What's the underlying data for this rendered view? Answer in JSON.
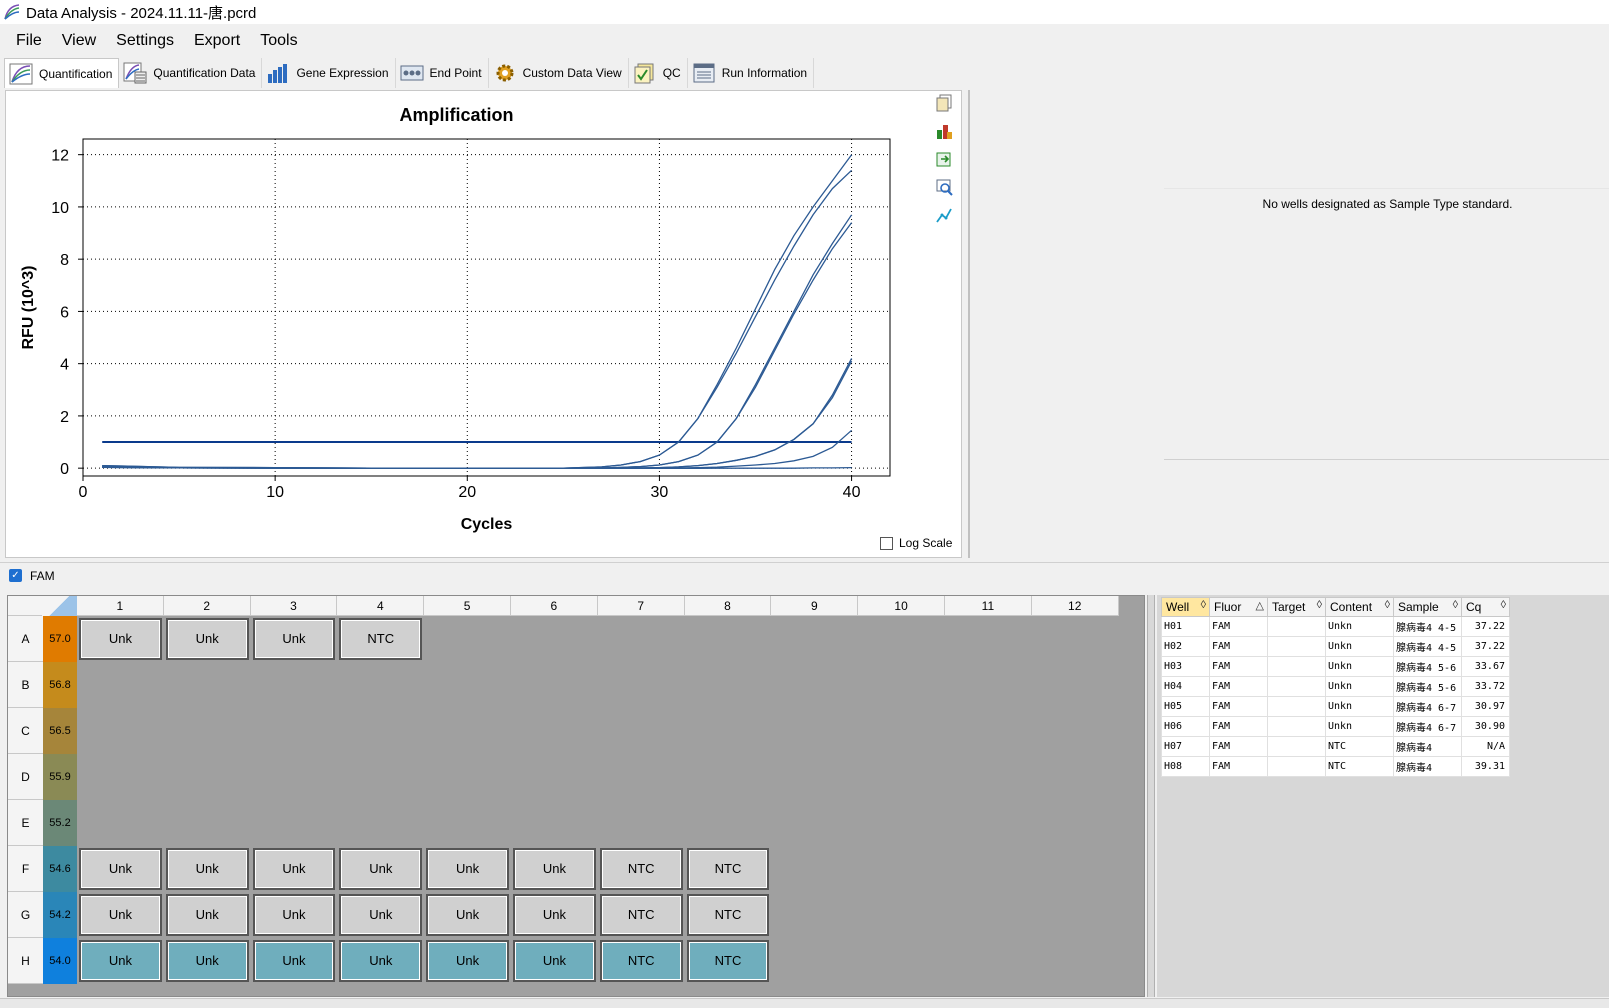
{
  "window": {
    "title": "Data Analysis - 2024.11.11-唐.pcrd"
  },
  "menu": [
    "File",
    "View",
    "Settings",
    "Export",
    "Tools"
  ],
  "tabs": [
    {
      "label": "Quantification",
      "icon": "quantification-icon",
      "active": true
    },
    {
      "label": "Quantification Data",
      "icon": "quantification-data-icon"
    },
    {
      "label": "Gene Expression",
      "icon": "bar-chart-icon"
    },
    {
      "label": "End Point",
      "icon": "end-point-icon"
    },
    {
      "label": "Custom Data View",
      "icon": "gear-icon"
    },
    {
      "label": "QC",
      "icon": "qc-check-icon"
    },
    {
      "label": "Run Information",
      "icon": "run-information-icon"
    }
  ],
  "chart_data": {
    "type": "line",
    "title": "Amplification",
    "xlabel": "Cycles",
    "ylabel": "RFU (10^3)",
    "xlim": [
      0,
      42
    ],
    "ylim": [
      -0.3,
      12.6
    ],
    "xticks": [
      0,
      10,
      20,
      30,
      40
    ],
    "yticks": [
      0,
      2,
      4,
      6,
      8,
      10,
      12
    ],
    "grid": true,
    "threshold": 1.0,
    "x": [
      1,
      5,
      10,
      15,
      20,
      25,
      27,
      28,
      29,
      30,
      31,
      32,
      33,
      34,
      35,
      36,
      37,
      38,
      39,
      40
    ],
    "series": [
      {
        "values": [
          0.1,
          0.03,
          0.02,
          0.0,
          -0.01,
          0.0,
          0.05,
          0.12,
          0.25,
          0.5,
          1.0,
          1.9,
          3.2,
          4.6,
          6.1,
          7.6,
          8.9,
          10.0,
          11.0,
          12.0
        ]
      },
      {
        "values": [
          0.1,
          0.03,
          0.02,
          0.0,
          -0.01,
          0.0,
          0.05,
          0.12,
          0.25,
          0.5,
          1.0,
          1.9,
          3.1,
          4.4,
          5.8,
          7.2,
          8.5,
          9.7,
          10.7,
          11.4
        ]
      },
      {
        "values": [
          0.06,
          0.02,
          0.01,
          0.0,
          -0.01,
          0.0,
          0.01,
          0.03,
          0.06,
          0.12,
          0.25,
          0.5,
          1.0,
          1.9,
          3.2,
          4.6,
          6.0,
          7.4,
          8.6,
          9.7
        ]
      },
      {
        "values": [
          0.06,
          0.02,
          0.01,
          0.0,
          -0.01,
          0.0,
          0.01,
          0.03,
          0.06,
          0.12,
          0.25,
          0.5,
          1.0,
          1.9,
          3.1,
          4.5,
          5.9,
          7.2,
          8.4,
          9.4
        ]
      },
      {
        "values": [
          0.04,
          0.01,
          0.0,
          -0.01,
          -0.01,
          0.0,
          0.0,
          0.0,
          0.01,
          0.02,
          0.05,
          0.1,
          0.18,
          0.3,
          0.45,
          0.7,
          1.1,
          1.7,
          2.7,
          4.1
        ]
      },
      {
        "values": [
          0.04,
          0.01,
          0.0,
          -0.01,
          -0.01,
          0.0,
          0.0,
          0.0,
          0.01,
          0.02,
          0.05,
          0.1,
          0.18,
          0.3,
          0.45,
          0.7,
          1.1,
          1.7,
          2.8,
          4.2
        ]
      },
      {
        "values": [
          0.03,
          0.01,
          0.0,
          -0.01,
          -0.01,
          -0.01,
          0.0,
          0.0,
          0.0,
          0.0,
          0.01,
          0.02,
          0.04,
          0.08,
          0.12,
          0.18,
          0.28,
          0.45,
          0.8,
          1.45
        ]
      },
      {
        "values": [
          0.03,
          0.01,
          0.0,
          -0.01,
          -0.01,
          -0.01,
          -0.01,
          -0.01,
          -0.01,
          -0.01,
          -0.01,
          -0.01,
          0.0,
          0.0,
          0.0,
          0.0,
          0.0,
          0.01,
          0.01,
          0.02
        ]
      }
    ]
  },
  "log_scale_label": "Log Scale",
  "standard_message": "No wells designated as Sample Type standard.",
  "fluor_filter": {
    "label": "FAM",
    "checked": true
  },
  "plate": {
    "columns": [
      "1",
      "2",
      "3",
      "4",
      "5",
      "6",
      "7",
      "8",
      "9",
      "10",
      "11",
      "12"
    ],
    "rows": [
      {
        "label": "A",
        "temp": "57.0",
        "temp_color": "#e07b00",
        "wells": [
          "Unk",
          "Unk",
          "Unk",
          "NTC"
        ],
        "style": "gray"
      },
      {
        "label": "B",
        "temp": "56.8",
        "temp_color": "#c58b1c",
        "wells": [],
        "style": "gray"
      },
      {
        "label": "C",
        "temp": "56.5",
        "temp_color": "#a6853a",
        "wells": [],
        "style": "gray"
      },
      {
        "label": "D",
        "temp": "55.9",
        "temp_color": "#8a8a55",
        "wells": [],
        "style": "gray"
      },
      {
        "label": "E",
        "temp": "55.2",
        "temp_color": "#6b8877",
        "wells": [],
        "style": "gray"
      },
      {
        "label": "F",
        "temp": "54.6",
        "temp_color": "#3d8aa0",
        "wells": [
          "Unk",
          "Unk",
          "Unk",
          "Unk",
          "Unk",
          "Unk",
          "NTC",
          "NTC"
        ],
        "style": "gray"
      },
      {
        "label": "G",
        "temp": "54.2",
        "temp_color": "#2a86b8",
        "wells": [
          "Unk",
          "Unk",
          "Unk",
          "Unk",
          "Unk",
          "Unk",
          "NTC",
          "NTC"
        ],
        "style": "gray"
      },
      {
        "label": "H",
        "temp": "54.0",
        "temp_color": "#0f80dd",
        "wells": [
          "Unk",
          "Unk",
          "Unk",
          "Unk",
          "Unk",
          "Unk",
          "NTC",
          "NTC"
        ],
        "style": "teal"
      }
    ]
  },
  "results_table": {
    "columns": [
      "Well",
      "Fluor",
      "Target",
      "Content",
      "Sample",
      "Cq"
    ],
    "sort_column": "Fluor",
    "rows": [
      [
        "H01",
        "FAM",
        "",
        "Unkn",
        "腺病毒4 4-5",
        "37.22"
      ],
      [
        "H02",
        "FAM",
        "",
        "Unkn",
        "腺病毒4 4-5",
        "37.22"
      ],
      [
        "H03",
        "FAM",
        "",
        "Unkn",
        "腺病毒4 5-6",
        "33.67"
      ],
      [
        "H04",
        "FAM",
        "",
        "Unkn",
        "腺病毒4 5-6",
        "33.72"
      ],
      [
        "H05",
        "FAM",
        "",
        "Unkn",
        "腺病毒4 6-7",
        "30.97"
      ],
      [
        "H06",
        "FAM",
        "",
        "Unkn",
        "腺病毒4 6-7",
        "30.90"
      ],
      [
        "H07",
        "FAM",
        "",
        "NTC",
        "腺病毒4",
        "N/A"
      ],
      [
        "H08",
        "FAM",
        "",
        "NTC",
        "腺病毒4",
        "39.31"
      ]
    ]
  }
}
